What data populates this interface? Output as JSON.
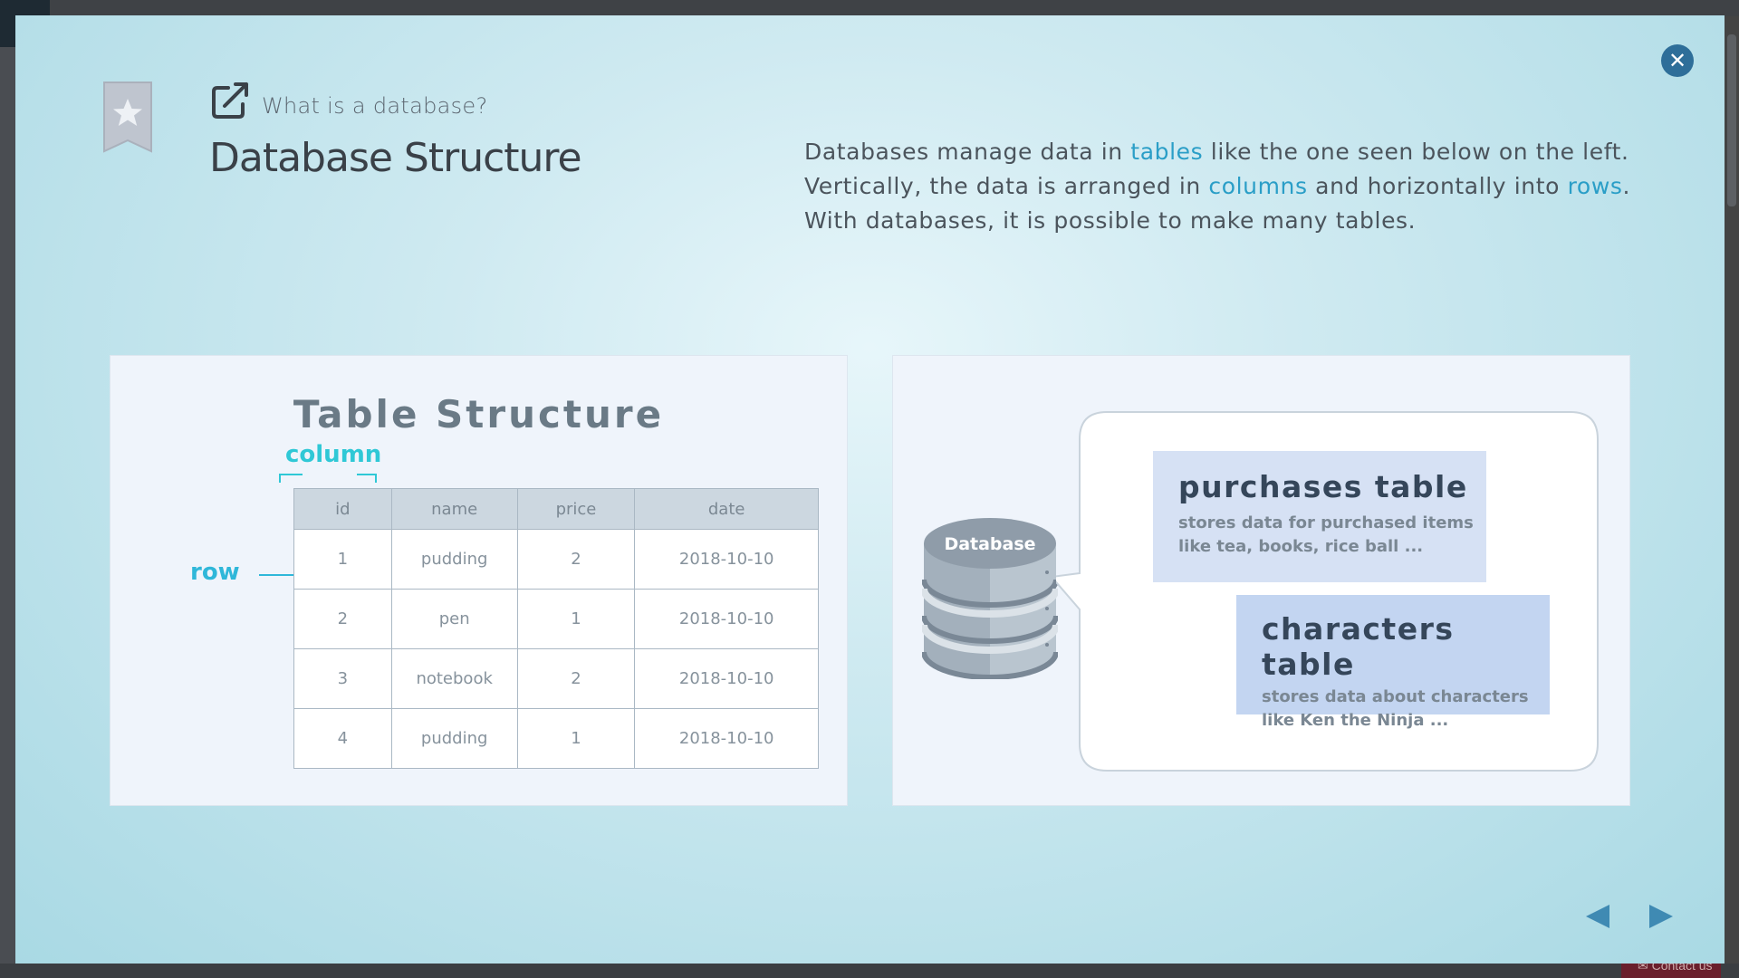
{
  "background": {
    "contact_label": "Contact us"
  },
  "modal": {
    "subtitle": "What is a database?",
    "title": "Database Structure",
    "description": {
      "line1_pre": "Databases manage data in ",
      "line1_hl": "tables",
      "line1_post": " like the one seen below on the left.",
      "line2_pre": "Vertically, the data is arranged in ",
      "line2_hl1": "columns",
      "line2_mid": " and horizontally into ",
      "line2_hl2": "rows",
      "line2_post": ".",
      "line3": "With databases, it is possible to make many tables."
    },
    "close_icon": "close-icon",
    "bookmark_icon": "bookmark-star-icon",
    "link_icon": "external-link-icon"
  },
  "table_panel": {
    "title": "Table Structure",
    "column_label": "column",
    "row_label": "row",
    "headers": [
      "id",
      "name",
      "price",
      "date"
    ],
    "rows": [
      [
        "1",
        "pudding",
        "2",
        "2018-10-10"
      ],
      [
        "2",
        "pen",
        "1",
        "2018-10-10"
      ],
      [
        "3",
        "notebook",
        "2",
        "2018-10-10"
      ],
      [
        "4",
        "pudding",
        "1",
        "2018-10-10"
      ]
    ]
  },
  "db_panel": {
    "db_label": "Database",
    "tables": [
      {
        "title": "purchases table",
        "desc": "stores data for purchased items\nlike tea, books, rice ball ..."
      },
      {
        "title": "characters table",
        "desc": "stores data about characters\nlike Ken the Ninja ..."
      }
    ]
  },
  "colors": {
    "accent": "#2a9ec7",
    "label_cyan": "#2fc8d6",
    "close_button": "#2e6e99",
    "nav_arrow": "#3f8ab3"
  }
}
